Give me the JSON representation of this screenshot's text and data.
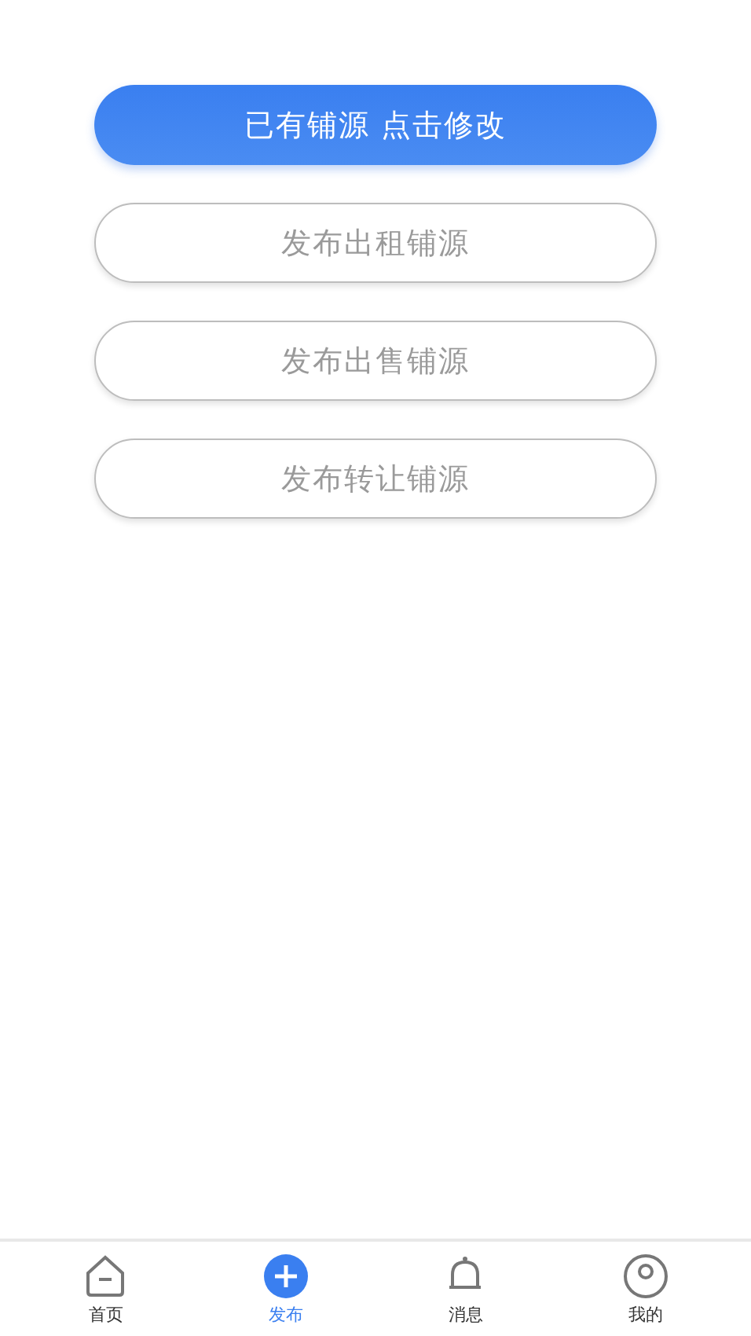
{
  "actions": [
    {
      "label": "已有铺源 点击修改",
      "kind": "primary"
    },
    {
      "label": "发布出租铺源",
      "kind": "outline"
    },
    {
      "label": "发布出售铺源",
      "kind": "outline"
    },
    {
      "label": "发布转让铺源",
      "kind": "outline"
    }
  ],
  "tab_bar": [
    {
      "label": "首页",
      "kind": "home",
      "selected": false
    },
    {
      "label": "发布",
      "kind": "plus",
      "selected": true
    },
    {
      "label": "消息",
      "kind": "bell",
      "selected": false
    },
    {
      "label": "我的",
      "kind": "person",
      "selected": false
    }
  ]
}
